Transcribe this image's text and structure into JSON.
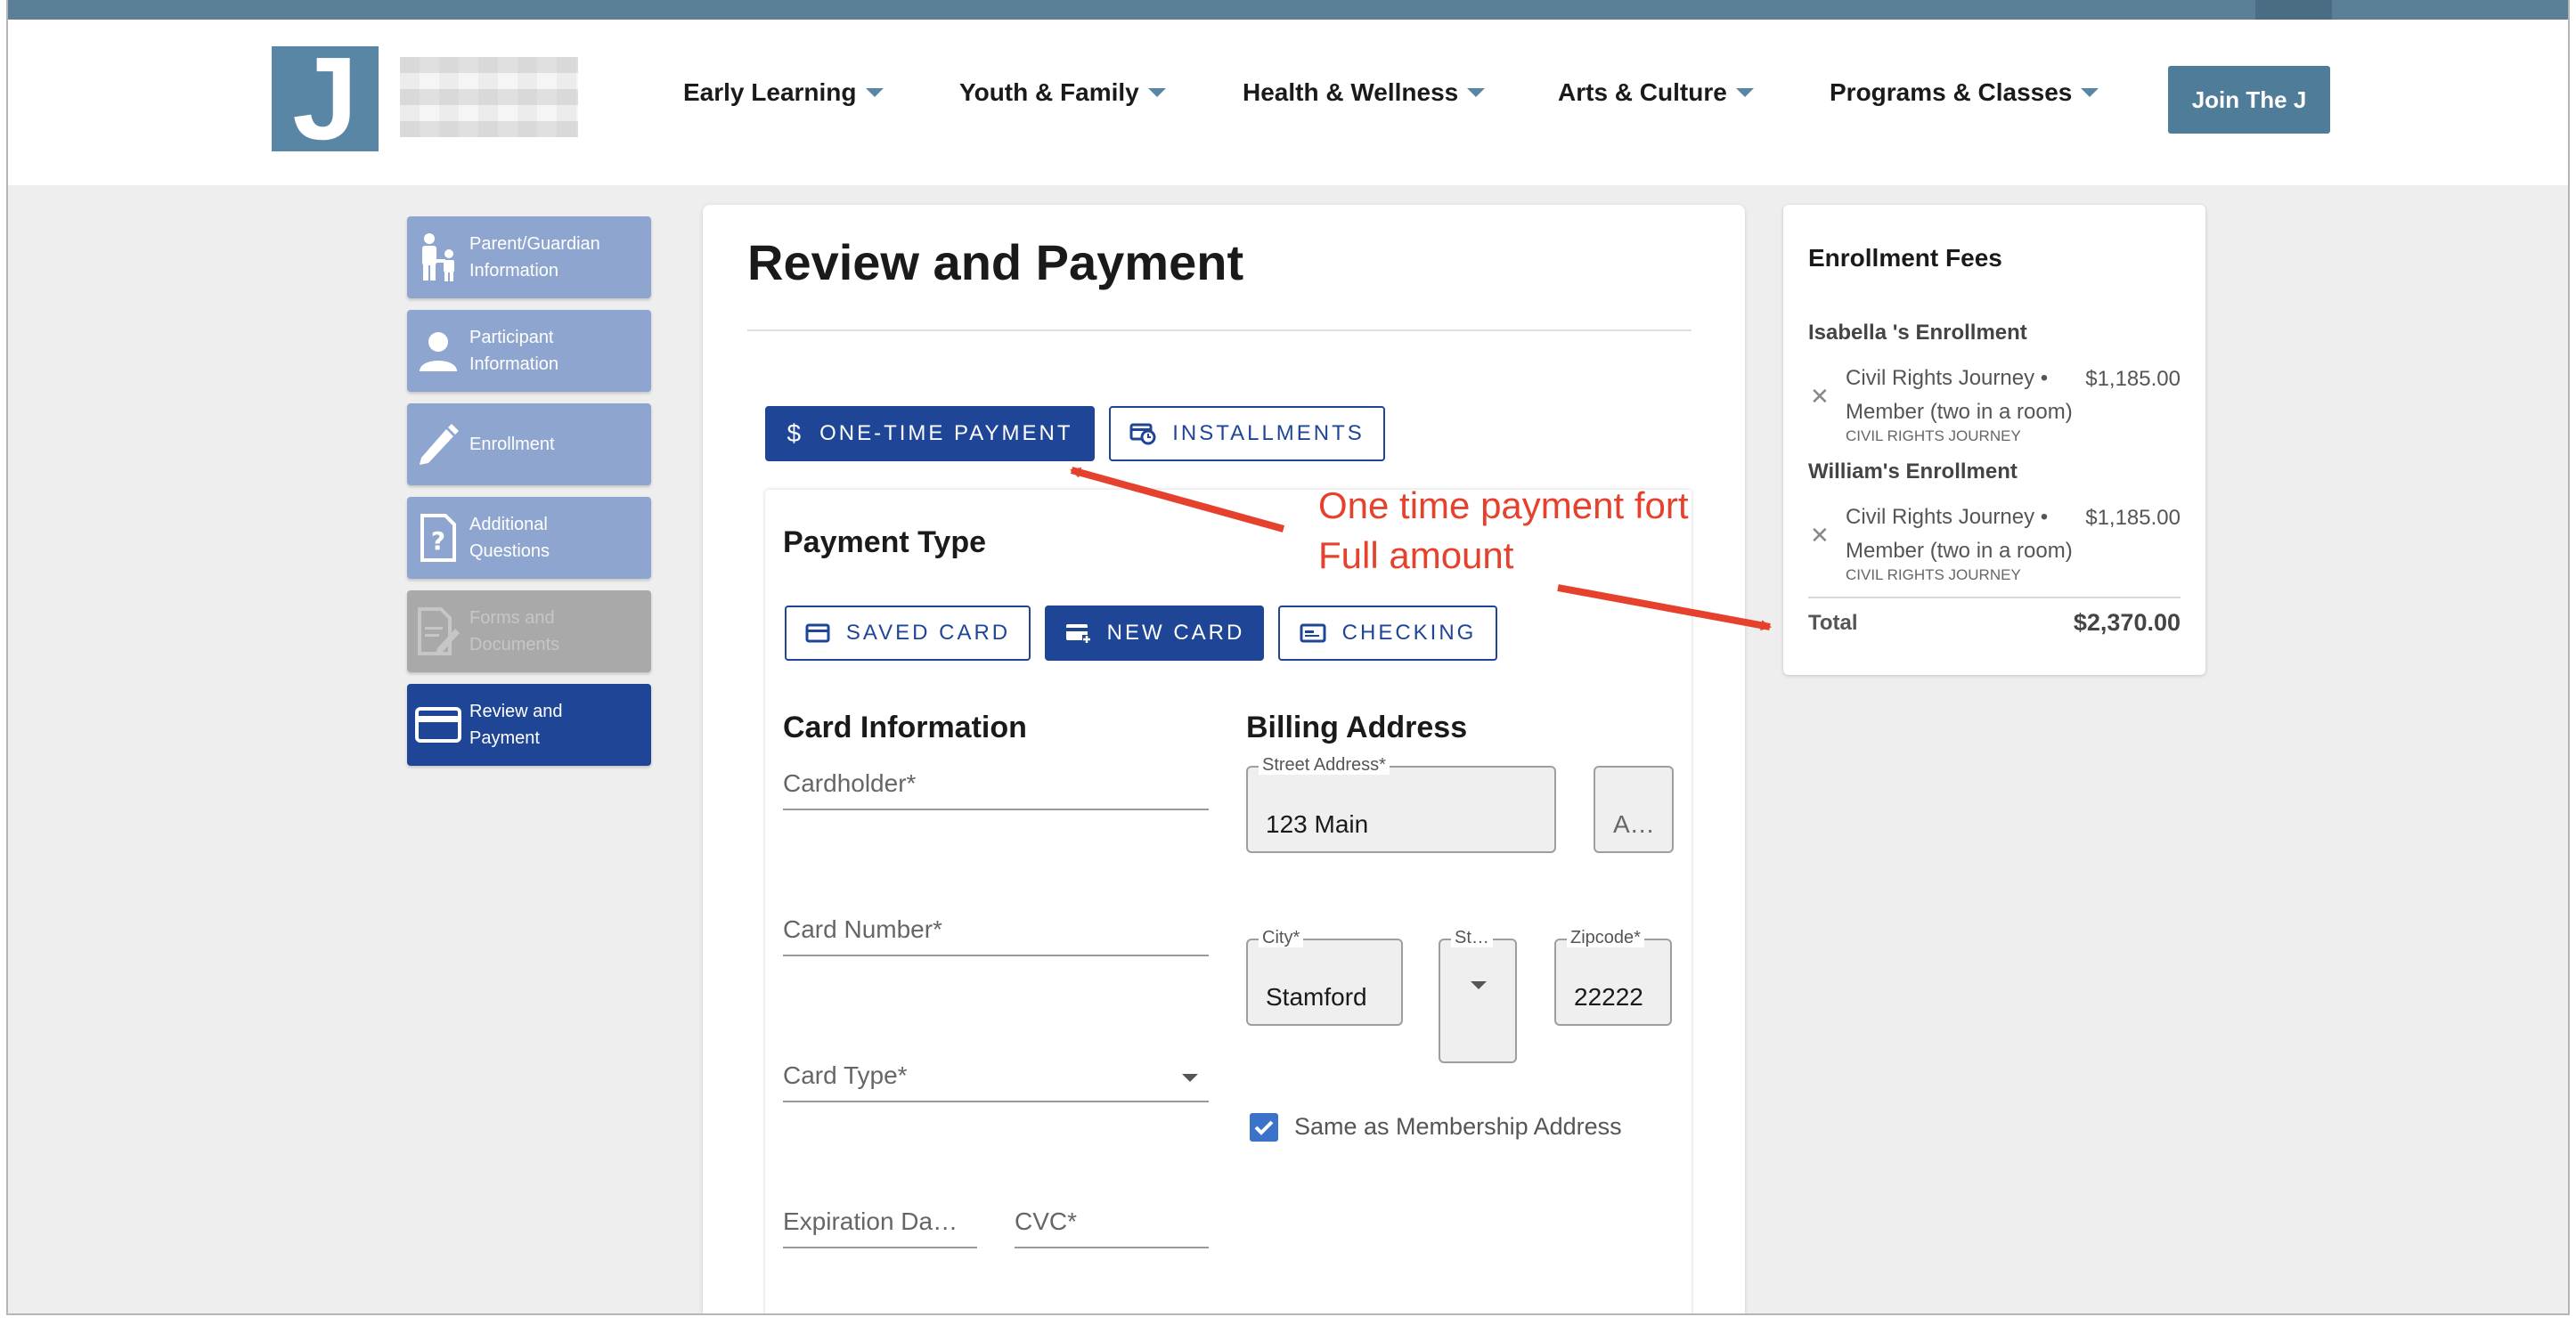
{
  "header": {
    "logo_letter": "J",
    "nav": [
      {
        "label": "Early Learning"
      },
      {
        "label": "Youth & Family"
      },
      {
        "label": "Health & Wellness"
      },
      {
        "label": "Arts & Culture"
      },
      {
        "label": "Programs & Classes"
      }
    ],
    "join_label": "Join The J"
  },
  "sidebar": {
    "items": [
      {
        "label": "Parent/Guardian Information",
        "state": "completed"
      },
      {
        "label": "Participant Information",
        "state": "completed"
      },
      {
        "label": "Enrollment",
        "state": "completed"
      },
      {
        "label": "Additional Questions",
        "state": "completed"
      },
      {
        "label": "Forms and Documents",
        "state": "disabled"
      },
      {
        "label": "Review and Payment",
        "state": "active"
      }
    ]
  },
  "main": {
    "title": "Review and Payment",
    "payment_modes": {
      "one_time": "ONE-TIME PAYMENT",
      "installments": "INSTALLMENTS",
      "selected": "one_time"
    },
    "payment_type": {
      "title": "Payment Type",
      "options": {
        "saved_card": "SAVED CARD",
        "new_card": "NEW CARD",
        "checking": "CHECKING"
      },
      "selected": "new_card"
    },
    "card_info": {
      "title": "Card Information",
      "cardholder": "Cardholder*",
      "card_number": "Card Number*",
      "card_type": "Card Type*",
      "expiration": "Expiration Da…",
      "cvc": "CVC*"
    },
    "billing": {
      "title": "Billing Address",
      "street_label": "Street Address*",
      "street_value": "123 Main",
      "apt_placeholder": "A…",
      "city_label": "City*",
      "city_value": "Stamford",
      "state_label": "St…",
      "zip_label": "Zipcode*",
      "zip_value": "22222",
      "same_as_label": "Same as Membership Address",
      "same_as_checked": true
    }
  },
  "fees": {
    "title": "Enrollment Fees",
    "enrollments": [
      {
        "name": "Isabella 's Enrollment",
        "item_line1": "Civil Rights Journey •",
        "item_line2": "Member (two in a room)",
        "price": "$1,185.00",
        "sub": "CIVIL RIGHTS JOURNEY"
      },
      {
        "name": "William's Enrollment",
        "item_line1": "Civil Rights Journey •",
        "item_line2": "Member (two in a room)",
        "price": "$1,185.00",
        "sub": "CIVIL RIGHTS JOURNEY"
      }
    ],
    "total_label": "Total",
    "total_value": "$2,370.00"
  },
  "annotation": {
    "line1": "One time payment fort",
    "line2": "Full amount",
    "color": "#e5412c"
  },
  "colors": {
    "primary": "#1f4596",
    "sidebar": "#8ea6cf",
    "brand": "#5a86a6"
  }
}
